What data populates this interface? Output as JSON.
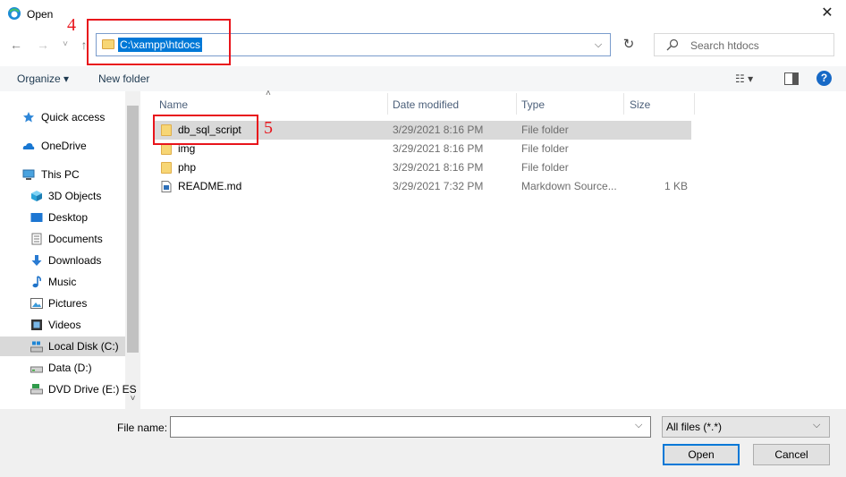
{
  "window": {
    "title": "Open",
    "close_glyph": "✕"
  },
  "nav_buttons": {
    "back": "←",
    "forward": "→",
    "recent": "˅",
    "up": "↑"
  },
  "address": {
    "path": "C:\\xampp\\htdocs",
    "dropdown": "⌵",
    "refresh": "↻"
  },
  "search": {
    "placeholder": "Search htdocs"
  },
  "toolbar": {
    "organize": "Organize ▾",
    "new_folder": "New folder",
    "view_glyph": "☷ ▾",
    "help": "?"
  },
  "annotations": {
    "step4": "4",
    "step5": "5"
  },
  "sidebar": {
    "items": [
      {
        "label": "Quick access",
        "icon": "star-icon"
      },
      {
        "label": "OneDrive",
        "icon": "cloud-icon"
      },
      {
        "label": "This PC",
        "icon": "computer-icon"
      },
      {
        "label": "3D Objects",
        "icon": "cube-icon"
      },
      {
        "label": "Desktop",
        "icon": "desktop-icon"
      },
      {
        "label": "Documents",
        "icon": "documents-icon"
      },
      {
        "label": "Downloads",
        "icon": "download-icon"
      },
      {
        "label": "Music",
        "icon": "music-icon"
      },
      {
        "label": "Pictures",
        "icon": "pictures-icon"
      },
      {
        "label": "Videos",
        "icon": "videos-icon"
      },
      {
        "label": "Local Disk (C:)",
        "icon": "local-disk-icon"
      },
      {
        "label": "Data (D:)",
        "icon": "drive-icon"
      },
      {
        "label": "DVD Drive (E:) ES",
        "icon": "dvd-drive-icon"
      }
    ],
    "scroll_down": "˅"
  },
  "columns": {
    "name": "Name",
    "date": "Date modified",
    "type": "Type",
    "size": "Size",
    "sort_glyph": "˄"
  },
  "files": [
    {
      "name": "db_sql_script",
      "date": "3/29/2021 8:16 PM",
      "type": "File folder",
      "size": ""
    },
    {
      "name": "img",
      "date": "3/29/2021 8:16 PM",
      "type": "File folder",
      "size": ""
    },
    {
      "name": "php",
      "date": "3/29/2021 8:16 PM",
      "type": "File folder",
      "size": ""
    },
    {
      "name": "README.md",
      "date": "3/29/2021 7:32 PM",
      "type": "Markdown Source...",
      "size": "1 KB"
    }
  ],
  "footer": {
    "file_name_label": "File name:",
    "file_name_value": "",
    "file_type": "All files (*.*)",
    "dropdown": "⌵",
    "open": "Open",
    "cancel": "Cancel"
  }
}
